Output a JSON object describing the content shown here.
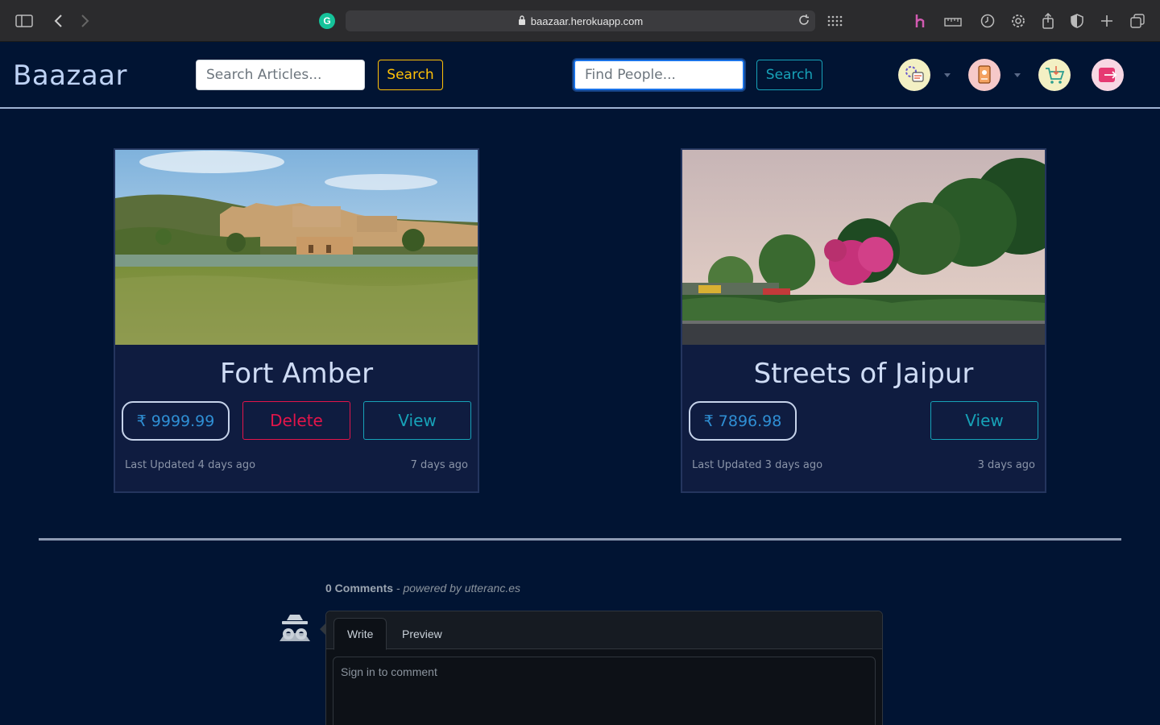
{
  "browser": {
    "url": "baazaar.herokuapp.com",
    "extension_letter": "G"
  },
  "navbar": {
    "brand": "Baazaar",
    "article_search": {
      "placeholder": "Search Articles...",
      "button": "Search"
    },
    "people_search": {
      "placeholder": "Find People...",
      "button": "Search"
    },
    "icons": [
      "profile-menu-icon",
      "notebook-icon",
      "cart-icon",
      "logout-icon"
    ]
  },
  "cards": [
    {
      "title": "Fort Amber",
      "price": "₹ 9999.99",
      "delete_label": "Delete",
      "view_label": "View",
      "updated": "Last Updated 4 days ago",
      "created": "7 days ago"
    },
    {
      "title": "Streets of Jaipur",
      "price": "₹ 7896.98",
      "view_label": "View",
      "updated": "Last Updated 3 days ago",
      "created": "3 days ago"
    }
  ],
  "comments": {
    "count_label": "0 Comments",
    "powered_by": "- powered by utteranc.es",
    "tab_write": "Write",
    "tab_preview": "Preview",
    "placeholder": "Sign in to comment"
  }
}
